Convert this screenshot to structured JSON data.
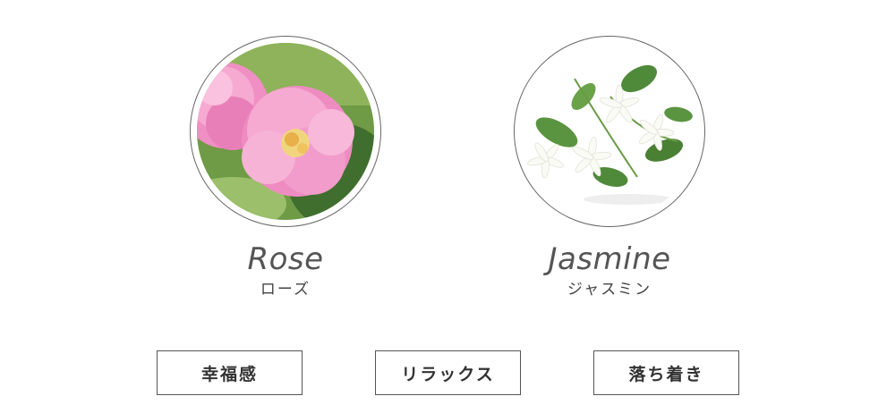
{
  "flowers": [
    {
      "name_en": "Rose",
      "name_ja": "ローズ",
      "image": "pink-rose-photo"
    },
    {
      "name_en": "Jasmine",
      "name_ja": "ジャスミン",
      "image": "white-jasmine-photo"
    }
  ],
  "tags": [
    "幸福感",
    "リラックス",
    "落ち着き"
  ],
  "colors": {
    "border": "#555555",
    "text": "#444444",
    "rose_pink": "#f0a0c8",
    "leaf_green": "#4f8a3a"
  }
}
